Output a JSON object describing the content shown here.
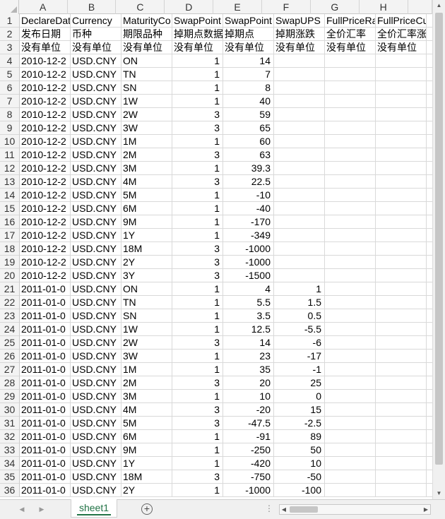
{
  "columns": [
    "A",
    "B",
    "C",
    "D",
    "E",
    "F",
    "G",
    "H"
  ],
  "rows": [
    {
      "n": "1",
      "c": [
        "DeclareDat",
        "Currency",
        "MaturityCo",
        "SwapPoint",
        "SwapPoint",
        "SwapUPS",
        "FullPriceRa",
        "FullPriceCu"
      ]
    },
    {
      "n": "2",
      "c": [
        "发布日期",
        "币种",
        "期限品种",
        "掉期点数据",
        "掉期点",
        "掉期涨跌",
        "全价汇率",
        "全价汇率涨"
      ]
    },
    {
      "n": "3",
      "c": [
        "没有单位",
        "没有单位",
        "没有单位",
        "没有单位",
        "没有单位",
        "没有单位",
        "没有单位",
        "没有单位"
      ]
    },
    {
      "n": "4",
      "c": [
        "2010-12-2",
        "USD.CNY",
        "ON",
        "1",
        "14",
        "",
        "",
        ""
      ]
    },
    {
      "n": "5",
      "c": [
        "2010-12-2",
        "USD.CNY",
        "TN",
        "1",
        "7",
        "",
        "",
        ""
      ]
    },
    {
      "n": "6",
      "c": [
        "2010-12-2",
        "USD.CNY",
        "SN",
        "1",
        "8",
        "",
        "",
        ""
      ]
    },
    {
      "n": "7",
      "c": [
        "2010-12-2",
        "USD.CNY",
        "1W",
        "1",
        "40",
        "",
        "",
        ""
      ]
    },
    {
      "n": "8",
      "c": [
        "2010-12-2",
        "USD.CNY",
        "2W",
        "3",
        "59",
        "",
        "",
        ""
      ]
    },
    {
      "n": "9",
      "c": [
        "2010-12-2",
        "USD.CNY",
        "3W",
        "3",
        "65",
        "",
        "",
        ""
      ]
    },
    {
      "n": "10",
      "c": [
        "2010-12-2",
        "USD.CNY",
        "1M",
        "1",
        "60",
        "",
        "",
        ""
      ]
    },
    {
      "n": "11",
      "c": [
        "2010-12-2",
        "USD.CNY",
        "2M",
        "3",
        "63",
        "",
        "",
        ""
      ]
    },
    {
      "n": "12",
      "c": [
        "2010-12-2",
        "USD.CNY",
        "3M",
        "1",
        "39.3",
        "",
        "",
        ""
      ]
    },
    {
      "n": "13",
      "c": [
        "2010-12-2",
        "USD.CNY",
        "4M",
        "3",
        "22.5",
        "",
        "",
        ""
      ]
    },
    {
      "n": "14",
      "c": [
        "2010-12-2",
        "USD.CNY",
        "5M",
        "1",
        "-10",
        "",
        "",
        ""
      ]
    },
    {
      "n": "15",
      "c": [
        "2010-12-2",
        "USD.CNY",
        "6M",
        "1",
        "-40",
        "",
        "",
        ""
      ]
    },
    {
      "n": "16",
      "c": [
        "2010-12-2",
        "USD.CNY",
        "9M",
        "1",
        "-170",
        "",
        "",
        ""
      ]
    },
    {
      "n": "17",
      "c": [
        "2010-12-2",
        "USD.CNY",
        "1Y",
        "1",
        "-349",
        "",
        "",
        ""
      ]
    },
    {
      "n": "18",
      "c": [
        "2010-12-2",
        "USD.CNY",
        "18M",
        "3",
        "-1000",
        "",
        "",
        ""
      ]
    },
    {
      "n": "19",
      "c": [
        "2010-12-2",
        "USD.CNY",
        "2Y",
        "3",
        "-1000",
        "",
        "",
        ""
      ]
    },
    {
      "n": "20",
      "c": [
        "2010-12-2",
        "USD.CNY",
        "3Y",
        "3",
        "-1500",
        "",
        "",
        ""
      ]
    },
    {
      "n": "21",
      "c": [
        "2011-01-0",
        "USD.CNY",
        "ON",
        "1",
        "4",
        "1",
        "",
        ""
      ]
    },
    {
      "n": "22",
      "c": [
        "2011-01-0",
        "USD.CNY",
        "TN",
        "1",
        "5.5",
        "1.5",
        "",
        ""
      ]
    },
    {
      "n": "23",
      "c": [
        "2011-01-0",
        "USD.CNY",
        "SN",
        "1",
        "3.5",
        "0.5",
        "",
        ""
      ]
    },
    {
      "n": "24",
      "c": [
        "2011-01-0",
        "USD.CNY",
        "1W",
        "1",
        "12.5",
        "-5.5",
        "",
        ""
      ]
    },
    {
      "n": "25",
      "c": [
        "2011-01-0",
        "USD.CNY",
        "2W",
        "3",
        "14",
        "-6",
        "",
        ""
      ]
    },
    {
      "n": "26",
      "c": [
        "2011-01-0",
        "USD.CNY",
        "3W",
        "1",
        "23",
        "-17",
        "",
        ""
      ]
    },
    {
      "n": "27",
      "c": [
        "2011-01-0",
        "USD.CNY",
        "1M",
        "1",
        "35",
        "-1",
        "",
        ""
      ]
    },
    {
      "n": "28",
      "c": [
        "2011-01-0",
        "USD.CNY",
        "2M",
        "3",
        "20",
        "25",
        "",
        ""
      ]
    },
    {
      "n": "29",
      "c": [
        "2011-01-0",
        "USD.CNY",
        "3M",
        "1",
        "10",
        "0",
        "",
        ""
      ]
    },
    {
      "n": "30",
      "c": [
        "2011-01-0",
        "USD.CNY",
        "4M",
        "3",
        "-20",
        "15",
        "",
        ""
      ]
    },
    {
      "n": "31",
      "c": [
        "2011-01-0",
        "USD.CNY",
        "5M",
        "3",
        "-47.5",
        "-2.5",
        "",
        ""
      ]
    },
    {
      "n": "32",
      "c": [
        "2011-01-0",
        "USD.CNY",
        "6M",
        "1",
        "-91",
        "89",
        "",
        ""
      ]
    },
    {
      "n": "33",
      "c": [
        "2011-01-0",
        "USD.CNY",
        "9M",
        "1",
        "-250",
        "50",
        "",
        ""
      ]
    },
    {
      "n": "34",
      "c": [
        "2011-01-0",
        "USD.CNY",
        "1Y",
        "1",
        "-420",
        "10",
        "",
        ""
      ]
    },
    {
      "n": "35",
      "c": [
        "2011-01-0",
        "USD.CNY",
        "18M",
        "3",
        "-750",
        "-50",
        "",
        ""
      ]
    },
    {
      "n": "36",
      "c": [
        "2011-01-0",
        "USD.CNY",
        "2Y",
        "1",
        "-1000",
        "-100",
        "",
        ""
      ]
    }
  ],
  "sheet_tab": "sheet1",
  "colors": {
    "accent": "#217346"
  },
  "icons": {
    "prev": "chevron-left-icon",
    "next": "chevron-right-icon",
    "add": "plus-circle-icon"
  }
}
